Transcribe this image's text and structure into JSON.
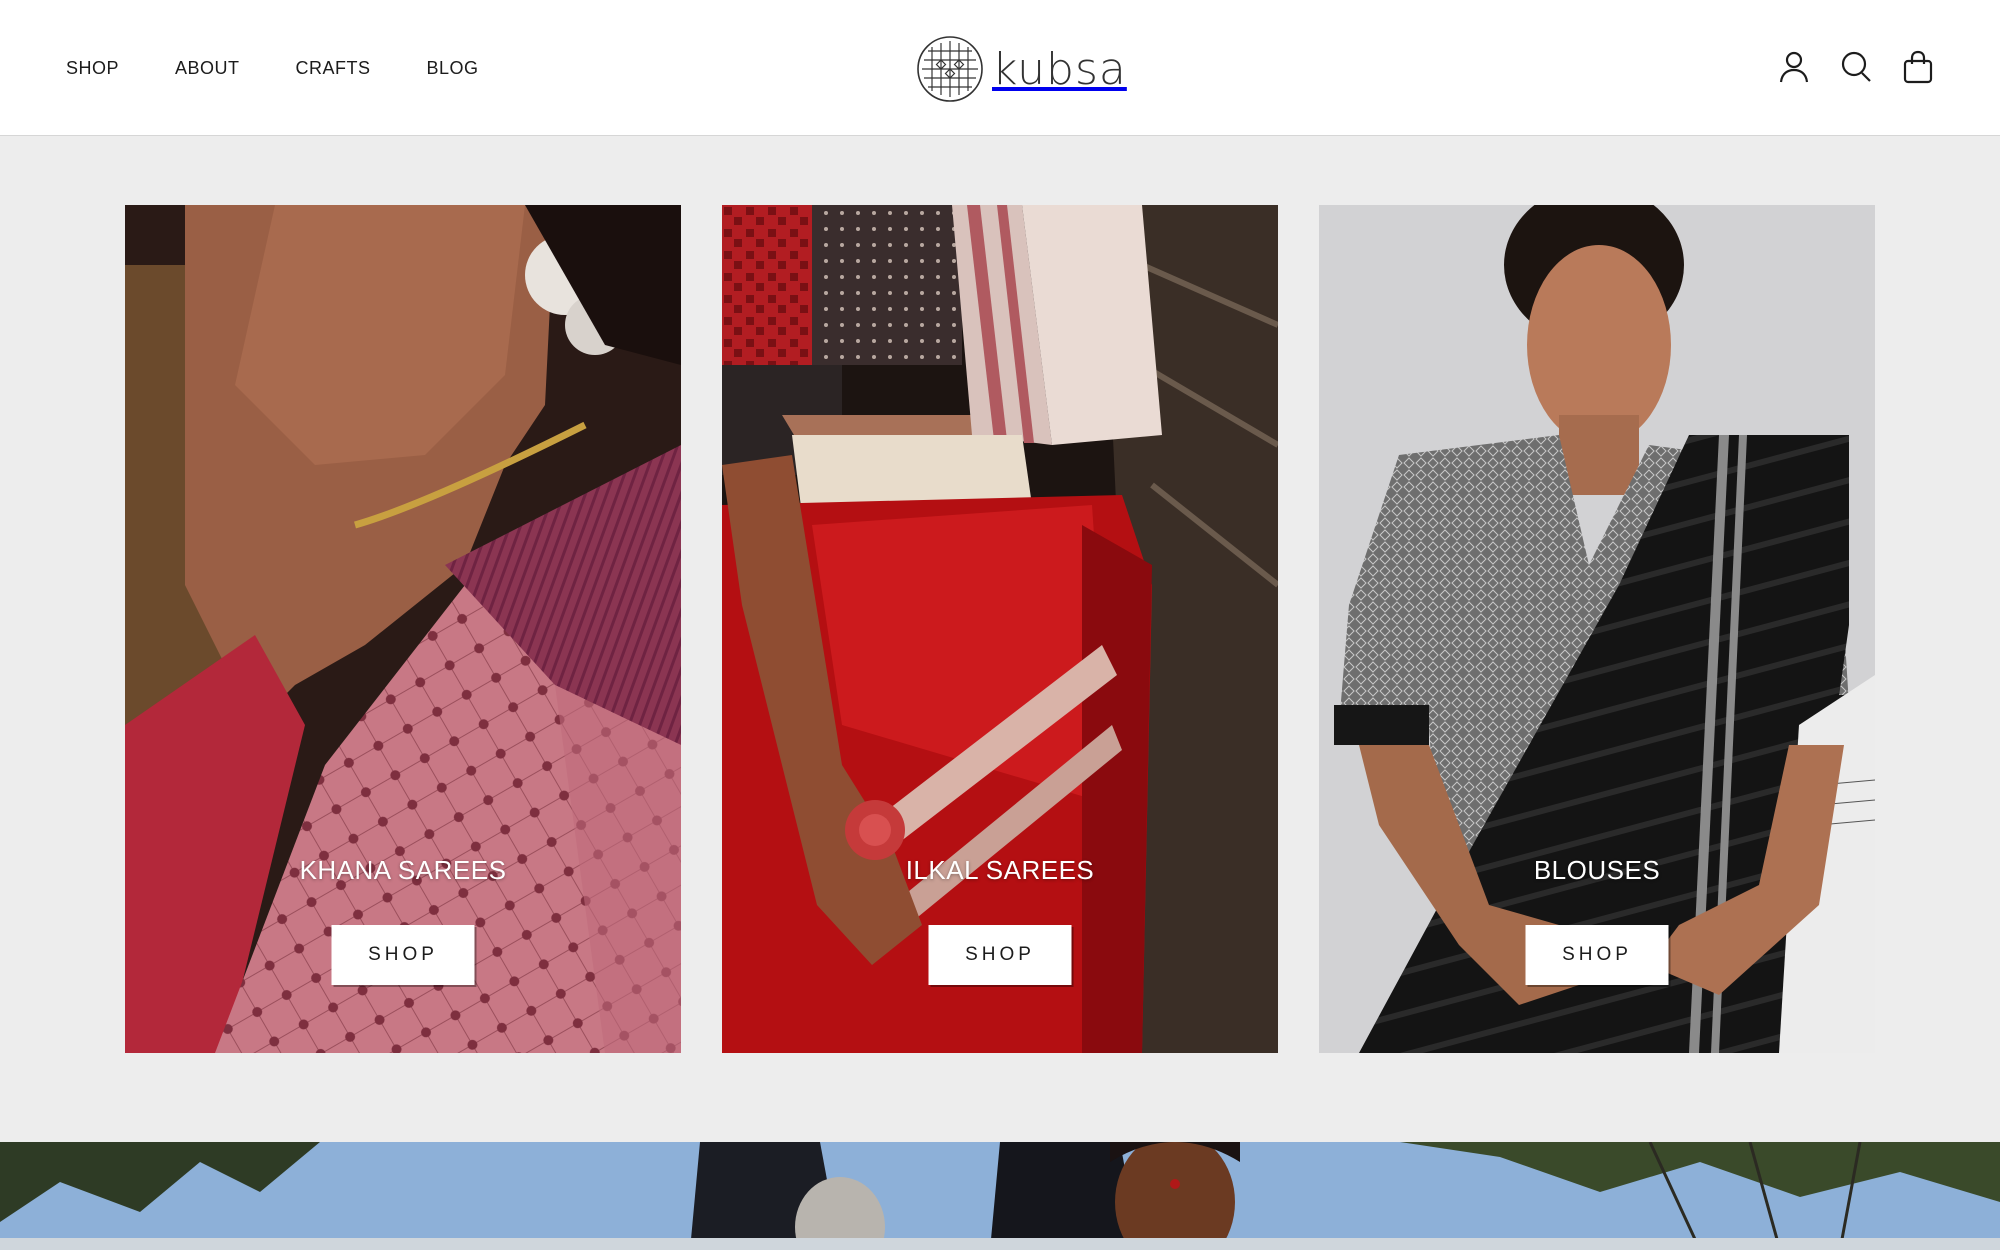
{
  "nav": {
    "items": [
      {
        "label": "SHOP"
      },
      {
        "label": "ABOUT"
      },
      {
        "label": "CRAFTS"
      },
      {
        "label": "BLOG"
      }
    ]
  },
  "brand": {
    "name": "kubsa"
  },
  "header_icons": [
    "account-icon",
    "search-icon",
    "cart-icon"
  ],
  "collections": [
    {
      "title": "KHANA SAREES",
      "button": "SHOP"
    },
    {
      "title": "ILKAL SAREES",
      "button": "SHOP"
    },
    {
      "title": "BLOUSES",
      "button": "SHOP"
    }
  ],
  "colors": {
    "header_bg": "#ffffff",
    "page_bg": "#ededed",
    "text": "#1c1c1c"
  }
}
